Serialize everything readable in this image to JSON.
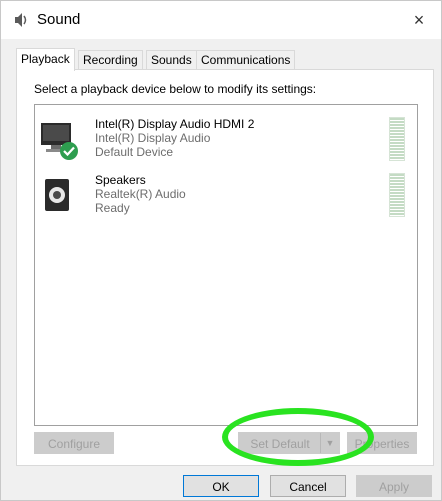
{
  "window": {
    "title": "Sound",
    "close_glyph": "×"
  },
  "tabs": [
    {
      "label": "Playback",
      "active": true
    },
    {
      "label": "Recording",
      "active": false
    },
    {
      "label": "Sounds",
      "active": false
    },
    {
      "label": "Communications",
      "active": false
    }
  ],
  "instructions": "Select a playback device below to modify its settings:",
  "devices": [
    {
      "name": "Intel(R) Display Audio HDMI 2",
      "driver": "Intel(R) Display Audio",
      "status": "Default Device",
      "icon": "monitor-icon",
      "default": true
    },
    {
      "name": "Speakers",
      "driver": "Realtek(R) Audio",
      "status": "Ready",
      "icon": "speaker-icon",
      "default": false
    }
  ],
  "panel_buttons": {
    "configure": "Configure",
    "set_default": "Set Default",
    "properties": "Properties"
  },
  "dialog_buttons": {
    "ok": "OK",
    "cancel": "Cancel",
    "apply": "Apply"
  },
  "colors": {
    "highlight": "#29e320",
    "default_check": "#2e9e4f"
  }
}
